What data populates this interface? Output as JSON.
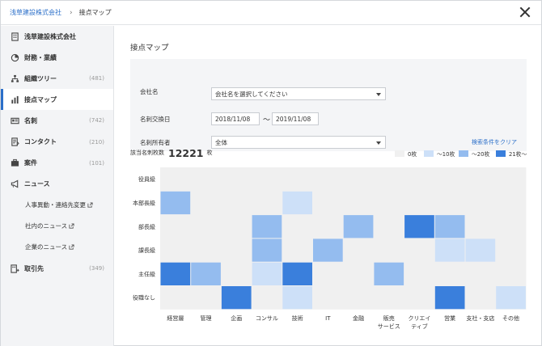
{
  "breadcrumb": {
    "root": "浅草建設株式会社",
    "current": "接点マップ"
  },
  "sidebar": {
    "items": [
      {
        "name": "sidebar-item-company",
        "icon": "building-icon",
        "label": "浅草建設株式会社",
        "count": ""
      },
      {
        "name": "sidebar-item-finance",
        "icon": "pie-chart-icon",
        "label": "財務・業績",
        "count": ""
      },
      {
        "name": "sidebar-item-org-tree",
        "icon": "org-chart-icon",
        "label": "組織ツリー",
        "count": "(481)"
      },
      {
        "name": "sidebar-item-contact-map",
        "icon": "bar-chart-icon",
        "label": "接点マップ",
        "count": "",
        "active": true
      },
      {
        "name": "sidebar-item-cards",
        "icon": "business-card-icon",
        "label": "名刺",
        "count": "(742)"
      },
      {
        "name": "sidebar-item-contacts",
        "icon": "contact-icon",
        "label": "コンタクト",
        "count": "(210)"
      },
      {
        "name": "sidebar-item-deals",
        "icon": "briefcase-icon",
        "label": "案件",
        "count": "(101)"
      },
      {
        "name": "sidebar-item-news",
        "icon": "megaphone-icon",
        "label": "ニュース",
        "count": ""
      }
    ],
    "news_sub": [
      {
        "name": "news-sub-personnel",
        "label": "人事異動・連絡先変更"
      },
      {
        "name": "news-sub-internal",
        "label": "社内のニュース"
      },
      {
        "name": "news-sub-company",
        "label": "企業のニュース"
      }
    ],
    "clients": {
      "icon": "company-link-icon",
      "label": "取引先",
      "count": "(349)"
    }
  },
  "page": {
    "title": "接点マップ"
  },
  "filters": {
    "company_label": "会社名",
    "company_value": "会社名を選択してください",
    "exchange_label": "名刺交換日",
    "date_from": "2018/11/08",
    "date_sep": "〜",
    "date_to": "2019/11/08",
    "owner_label": "名刺所有者",
    "owner_value": "全体",
    "clear_label": "検索条件をクリア"
  },
  "summary": {
    "label": "該当名刺枚数",
    "count": "12221",
    "unit": "枚"
  },
  "legend": [
    {
      "label": "0枚",
      "color": "#f0f0f0"
    },
    {
      "label": "～10枚",
      "color": "#cde0f8"
    },
    {
      "label": "～20枚",
      "color": "#94bcef"
    },
    {
      "label": "21枚～",
      "color": "#3a7fdc"
    }
  ],
  "chart_data": {
    "type": "heatmap",
    "rows": [
      "役員級",
      "本部長級",
      "部長級",
      "課長級",
      "主任級",
      "役職なし"
    ],
    "columns": [
      "経営層",
      "管理",
      "企画",
      "コンサル",
      "技術",
      "IT",
      "金融",
      "販売\nサービス",
      "クリエイ\nティブ",
      "営業",
      "支社・支店",
      "その他"
    ],
    "levels": [
      [
        0,
        0,
        0,
        0,
        0,
        0,
        0,
        0,
        0,
        0,
        0,
        0
      ],
      [
        2,
        0,
        0,
        0,
        1,
        0,
        0,
        0,
        0,
        0,
        0,
        0
      ],
      [
        0,
        0,
        0,
        2,
        0,
        0,
        2,
        0,
        3,
        2,
        0,
        0
      ],
      [
        0,
        0,
        0,
        2,
        0,
        2,
        0,
        0,
        0,
        1,
        1,
        0
      ],
      [
        3,
        2,
        0,
        1,
        3,
        0,
        0,
        2,
        0,
        0,
        0,
        0
      ],
      [
        0,
        0,
        3,
        0,
        1,
        0,
        0,
        0,
        0,
        3,
        0,
        1
      ]
    ],
    "level_colors": [
      "#f0f0f0",
      "#cde0f8",
      "#94bcef",
      "#3a7fdc"
    ]
  }
}
